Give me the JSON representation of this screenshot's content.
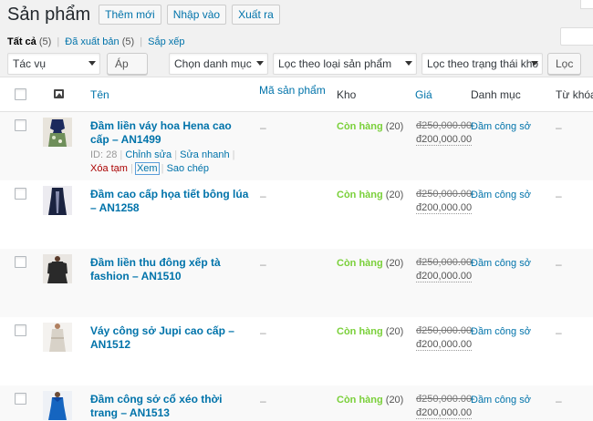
{
  "header": {
    "title": "Sản phẩm",
    "add_new": "Thêm mới",
    "import": "Nhập vào",
    "export": "Xuất ra"
  },
  "views": [
    {
      "label": "Tất cả",
      "count": "(5)"
    },
    {
      "label": "Đã xuất bản",
      "count": "(5)"
    },
    {
      "label": "Sắp xếp",
      "count": ""
    }
  ],
  "filters": {
    "bulk_action": "Tác vụ",
    "apply": "Áp dụng",
    "category": "Chọn danh mục",
    "product_type": "Lọc theo loại sản phẩm",
    "stock_status": "Lọc theo trạng thái kho",
    "filter_button": "Lọc"
  },
  "columns": {
    "name": "Tên",
    "sku": "Mã sản phẩm",
    "stock": "Kho",
    "price": "Giá",
    "categories": "Danh mục",
    "tags": "Từ khóa"
  },
  "empty_value": "–",
  "row_actions": {
    "id_prefix": "ID: 28",
    "edit": "Chỉnh sửa",
    "quick_edit": "Sửa nhanh",
    "trash": "Xóa tạm",
    "view": "Xem",
    "duplicate": "Sao chép"
  },
  "products": [
    {
      "name": "Đầm liền váy hoa Hena cao cấp – AN1499",
      "stock_status": "Còn hàng",
      "stock_qty": "(20)",
      "regular_price": "đ250,000.00",
      "sale_price": "đ200,000.00",
      "category": "Đầm công sở",
      "thumb_color": "#1c2a5c"
    },
    {
      "name": "Đầm cao cấp họa tiết bông lúa – AN1258",
      "stock_status": "Còn hàng",
      "stock_qty": "(20)",
      "regular_price": "đ250,000.00",
      "sale_price": "đ200,000.00",
      "category": "Đầm công sở",
      "thumb_color": "#1a2340"
    },
    {
      "name": "Đầm liền thu đông xếp tà fashion – AN1510",
      "stock_status": "Còn hàng",
      "stock_qty": "(20)",
      "regular_price": "đ250,000.00",
      "sale_price": "đ200,000.00",
      "category": "Đầm công sở",
      "thumb_color": "#2a2a2a"
    },
    {
      "name": "Váy công sở Jupi cao cấp – AN1512",
      "stock_status": "Còn hàng",
      "stock_qty": "(20)",
      "regular_price": "đ250,000.00",
      "sale_price": "đ200,000.00",
      "category": "Đầm công sở",
      "thumb_color": "#d8d2c8"
    },
    {
      "name": "Đầm công sở cổ xéo thời trang – AN1513",
      "stock_status": "Còn hàng",
      "stock_qty": "(20)",
      "regular_price": "đ250,000.00",
      "sale_price": "đ200,000.00",
      "category": "Đầm công sở",
      "thumb_color": "#1565c0"
    }
  ]
}
